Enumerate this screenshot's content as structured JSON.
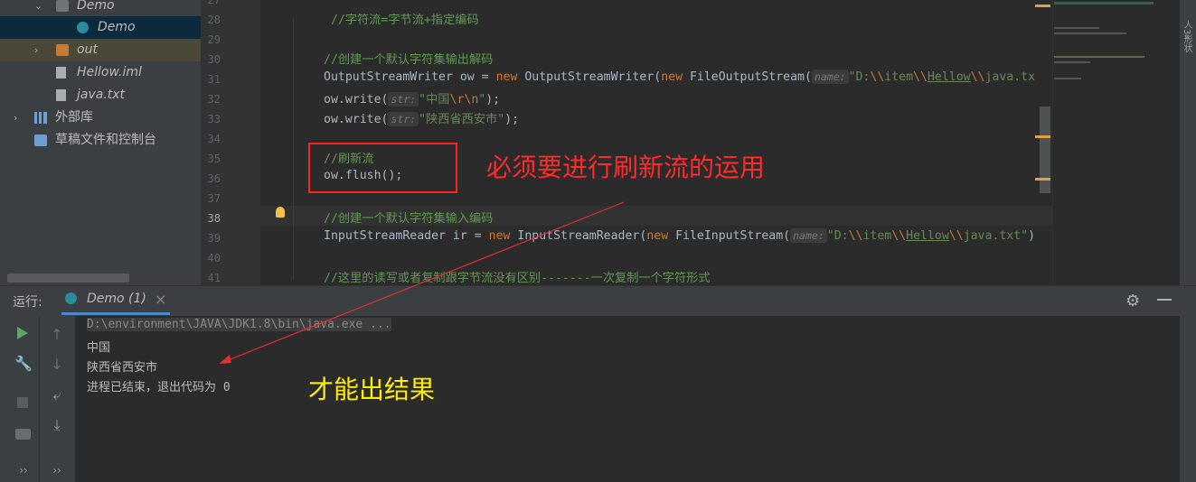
{
  "project_tree": {
    "items": [
      {
        "label": "Demo",
        "kind": "package"
      },
      {
        "label": "Demo",
        "kind": "class"
      },
      {
        "label": "out",
        "kind": "folder"
      },
      {
        "label": "Hellow.iml",
        "kind": "file"
      },
      {
        "label": "java.txt",
        "kind": "file"
      },
      {
        "label": "外部库",
        "kind": "library"
      },
      {
        "label": "草稿文件和控制台",
        "kind": "scratches"
      }
    ]
  },
  "editor": {
    "line_numbers": [
      "27",
      "28",
      "29",
      "30",
      "31",
      "32",
      "33",
      "34",
      "35",
      "36",
      "37",
      "38",
      "39",
      "40",
      "41"
    ],
    "current_line": "38",
    "code": {
      "l28": "//字符流=字节流+指定编码",
      "l30": "//创建一个默认字符集输出解码",
      "l31_type": "OutputStreamWriter ow = ",
      "l31_new": "new",
      "l31_mid": " OutputStreamWriter(",
      "l31_new2": "new",
      "l31_mid2": " FileOutputStream(",
      "l31_hint": "name:",
      "l31_str_a": "\"D:",
      "l31_esc1": "\\\\",
      "l31_str_b": "item",
      "l31_esc2": "\\\\",
      "l31_str_c": "Hellow",
      "l31_esc3": "\\\\",
      "l31_str_d": "java.tx",
      "l32_pre": "ow.write(",
      "l32_hint": "str:",
      "l32_str_a": "\"中国",
      "l32_esc": "\\r\\n",
      "l32_str_b": "\"",
      "l32_post": ");",
      "l33_pre": "ow.write(",
      "l33_hint": "str:",
      "l33_str": "\"陕西省西安市\"",
      "l33_post": ");",
      "l35": "//刷新流",
      "l36": "ow.flush();",
      "l38": "//创建一个默认字符集输入编码",
      "l39_type": "InputStreamReader ir = ",
      "l39_new": "new",
      "l39_mid": " InputStreamReader(",
      "l39_new2": "new",
      "l39_mid2": " FileInputStream(",
      "l39_hint": "name:",
      "l39_str_a": "\"D:",
      "l39_esc1": "\\\\",
      "l39_str_b": "item",
      "l39_esc2": "\\\\",
      "l39_str_c": "Hellow",
      "l39_esc3": "\\\\",
      "l39_str_d": "java.txt\"",
      "l39_post": ")",
      "l41": "//这里的读写或者复制跟字节流没有区别-------一次复制一个字符形式"
    }
  },
  "annotations": {
    "note_flush": "必须要进行刷新流的运用",
    "note_result": "才能出结果"
  },
  "run_panel": {
    "label": "运行:",
    "tab_label": "Demo (1)",
    "close": "×",
    "console_lines": [
      "D:\\environment\\JAVA\\JDK1.8\\bin\\java.exe ...",
      "中国",
      "陕西省西安市",
      "进程已结束，退出代码为 0"
    ]
  },
  "side_tab_label": "人3形状",
  "colors": {
    "accent": "#4a88c7",
    "annotation_red": "#ff2a2a",
    "annotation_yellow": "#ffee00",
    "warning_mark": "#e0a33a"
  }
}
